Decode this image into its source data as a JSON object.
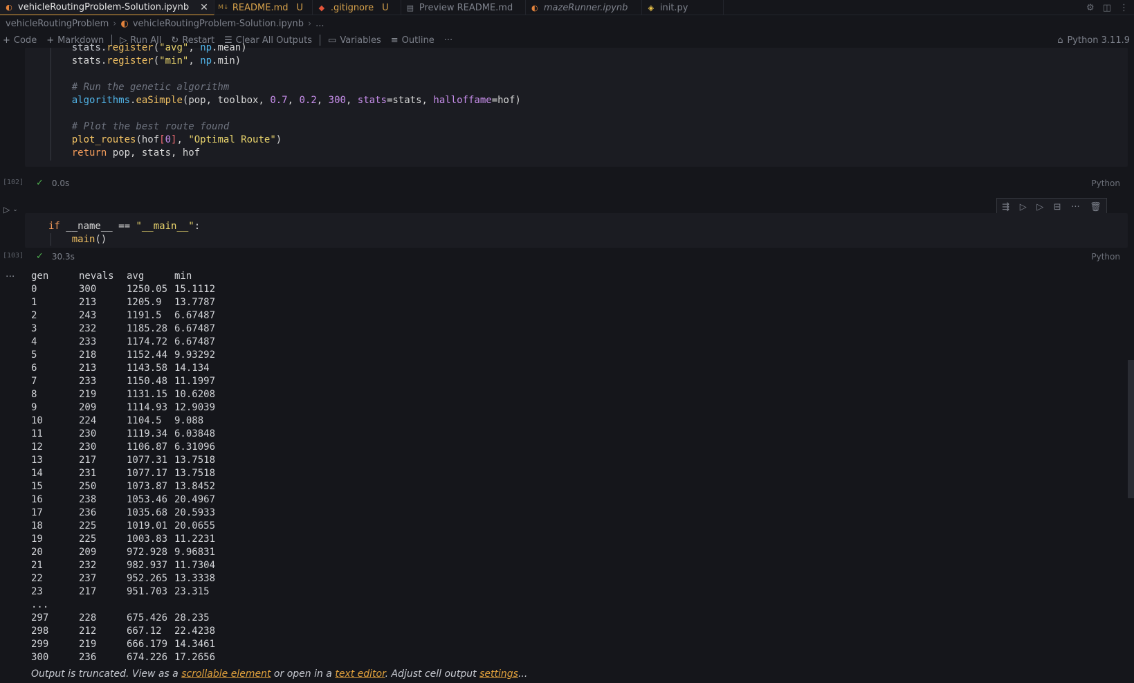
{
  "tabs": [
    {
      "label": "vehicleRoutingProblem-Solution.ipynb",
      "icon": "jupyter-icon",
      "active": true,
      "suffix": ""
    },
    {
      "label": "README.md",
      "icon": "markdown-icon",
      "active": false,
      "suffix": "U"
    },
    {
      "label": ".gitignore",
      "icon": "git-icon",
      "active": false,
      "suffix": "U"
    },
    {
      "label": "Preview README.md",
      "icon": "preview-icon",
      "active": false,
      "suffix": ""
    },
    {
      "label": "mazeRunner.ipynb",
      "icon": "jupyter-icon",
      "active": false,
      "suffix": ""
    },
    {
      "label": "init.py",
      "icon": "python-icon",
      "active": false,
      "suffix": ""
    }
  ],
  "breadcrumb": {
    "folder": "vehicleRoutingProblem",
    "file": "vehicleRoutingProblem-Solution.ipynb",
    "more": "..."
  },
  "toolbar": {
    "code": "Code",
    "markdown": "Markdown",
    "run_all": "Run All",
    "restart": "Restart",
    "clear_outputs": "Clear All Outputs",
    "variables": "Variables",
    "outline": "Outline",
    "more": "···",
    "kernel": "Python 3.11.9"
  },
  "cell1": {
    "count": "[102]",
    "time": "0.0s",
    "lang": "Python"
  },
  "cell2": {
    "count": "[103]",
    "time": "30.3s",
    "lang": "Python"
  },
  "output": {
    "headers": [
      "gen",
      "nevals",
      "avg",
      "min"
    ],
    "rows": [
      [
        "0",
        "300",
        "1250.05",
        "15.1112"
      ],
      [
        "1",
        "213",
        "1205.9",
        "13.7787"
      ],
      [
        "2",
        "243",
        "1191.5",
        "6.67487"
      ],
      [
        "3",
        "232",
        "1185.28",
        "6.67487"
      ],
      [
        "4",
        "233",
        "1174.72",
        "6.67487"
      ],
      [
        "5",
        "218",
        "1152.44",
        "9.93292"
      ],
      [
        "6",
        "213",
        "1143.58",
        "14.134"
      ],
      [
        "7",
        "233",
        "1150.48",
        "11.1997"
      ],
      [
        "8",
        "219",
        "1131.15",
        "10.6208"
      ],
      [
        "9",
        "209",
        "1114.93",
        "12.9039"
      ],
      [
        "10",
        "224",
        "1104.5",
        "9.088"
      ],
      [
        "11",
        "230",
        "1119.34",
        "6.03848"
      ],
      [
        "12",
        "230",
        "1106.87",
        "6.31096"
      ],
      [
        "13",
        "217",
        "1077.31",
        "13.7518"
      ],
      [
        "14",
        "231",
        "1077.17",
        "13.7518"
      ],
      [
        "15",
        "250",
        "1073.87",
        "13.8452"
      ],
      [
        "16",
        "238",
        "1053.46",
        "20.4967"
      ],
      [
        "17",
        "236",
        "1035.68",
        "20.5933"
      ],
      [
        "18",
        "225",
        "1019.01",
        "20.0655"
      ],
      [
        "19",
        "225",
        "1003.83",
        "11.2231"
      ],
      [
        "20",
        "209",
        "972.928",
        "9.96831"
      ],
      [
        "21",
        "232",
        "982.937",
        "11.7304"
      ],
      [
        "22",
        "237",
        "952.265",
        "13.3338"
      ],
      [
        "23",
        "217",
        "951.703",
        "23.315"
      ]
    ],
    "ellipsis": "...",
    "tail_rows": [
      [
        "297",
        "228",
        "675.426",
        "28.235"
      ],
      [
        "298",
        "212",
        "667.12",
        "22.4238"
      ],
      [
        "299",
        "219",
        "666.179",
        "14.3461"
      ],
      [
        "300",
        "236",
        "674.226",
        "17.2656"
      ]
    ],
    "trunc": {
      "t1": "Output is truncated. View as a ",
      "link1": "scrollable element",
      "t2": " or open in a ",
      "link2": "text editor",
      "t3": ". Adjust cell output ",
      "link3": "settings",
      "t4": "..."
    }
  }
}
